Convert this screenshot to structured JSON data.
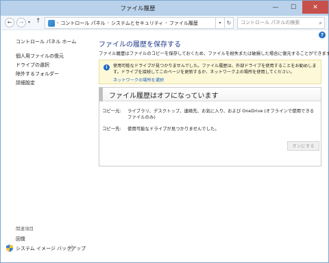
{
  "window": {
    "title": "ファイル履歴",
    "controls": {
      "minimize": "—",
      "maximize": "☐",
      "close": "✕"
    }
  },
  "address_bar": {
    "back": "←",
    "forward": "→",
    "up": "↑",
    "crumbs": [
      "コントロール パネル",
      "システムとセキュリティ",
      "ファイル履歴"
    ],
    "crumb_separator": "›",
    "refresh": "↻",
    "search_placeholder": "コントロール パネルの検索"
  },
  "help_icon": "?",
  "left_pane": {
    "home": "コントロール パネル ホーム",
    "links": [
      "個人用ファイルの復元",
      "ドライブの選択",
      "除外するフォルダー",
      "詳細設定"
    ],
    "related_header": "関連項目",
    "related_links": [
      "回復",
      "システム イメージ バックアップ"
    ]
  },
  "main": {
    "heading": "ファイルの履歴を保存する",
    "description": "ファイル履歴はファイルのコピーを保存しておくため、ファイルを紛失または破損した場合に復元することができます。",
    "info": {
      "text": "使用可能なドライブが見つかりませんでした。ファイル履歴は、外部ドライブを使用することをお勧めしま\nす。ドライブを接続してこのページを更新するか、ネットワーク上の場所を使用してください。",
      "link": "ネットワークの場所を選択"
    },
    "status": {
      "title": "ファイル履歴はオフになっています",
      "copy_from_label": "コピー元:",
      "copy_from_value": "ライブラリ、デスクトップ、連絡先、お気に入り、および OneDrive (オフラインで使用できるファイルのみ)",
      "copy_to_label": "コピー先:",
      "copy_to_value": "使用可能なドライブが見つかりませんでした。",
      "button": "オンにする"
    }
  }
}
